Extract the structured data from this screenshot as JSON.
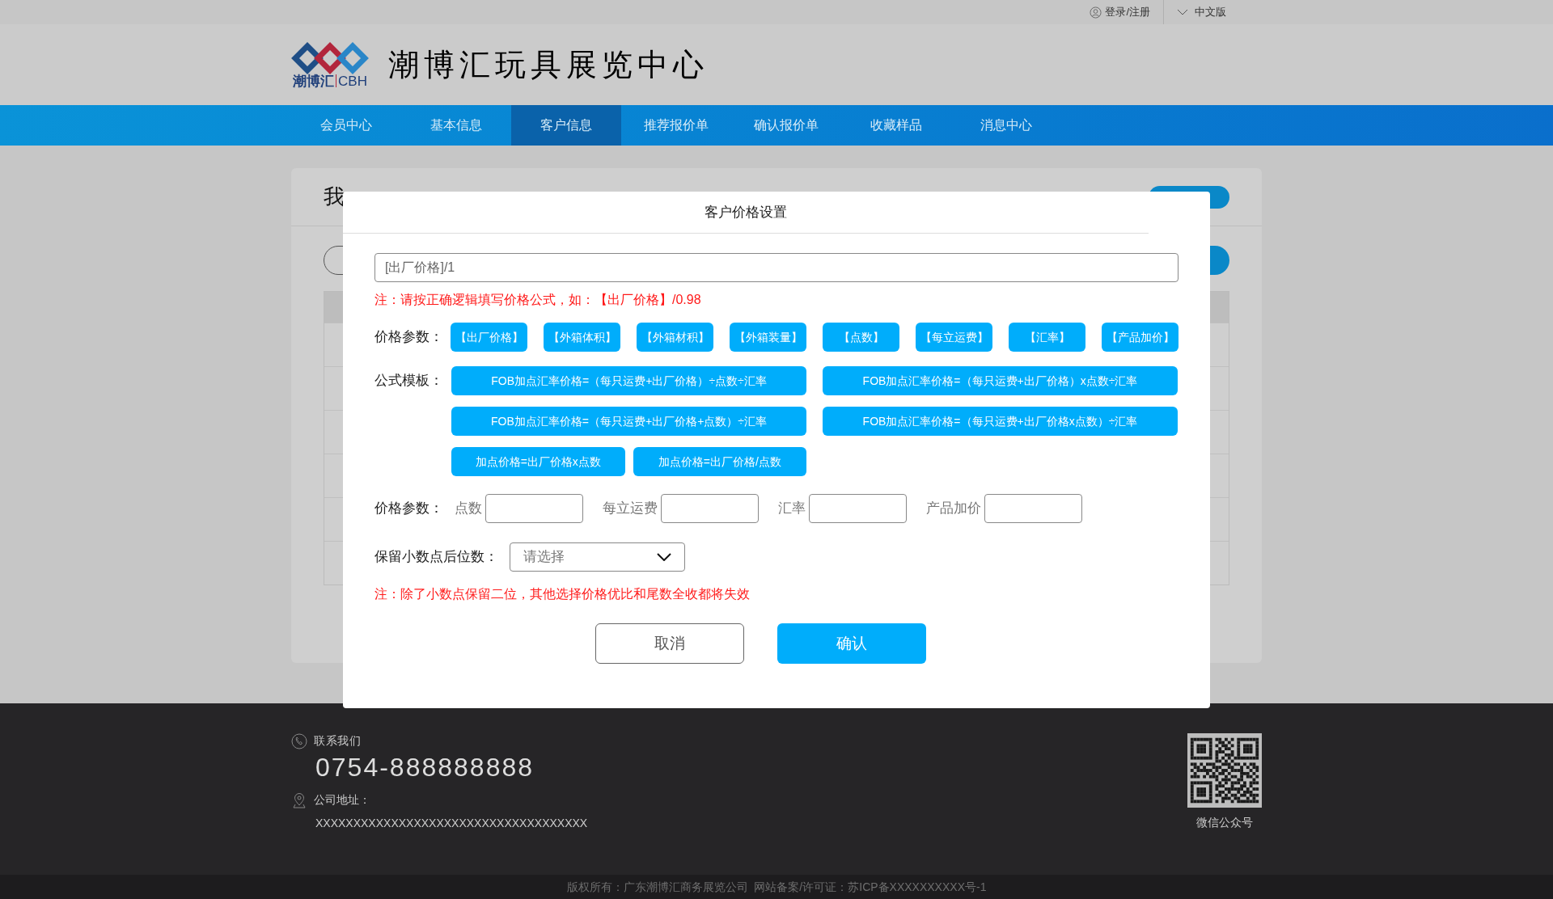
{
  "top_bar": {
    "login": "登录/注册",
    "language": "中文版"
  },
  "header": {
    "logo_cn": "潮博汇",
    "logo_en": "CBH",
    "site_title": "潮博汇玩具展览中心"
  },
  "nav": [
    {
      "label": "会员中心",
      "selected": false
    },
    {
      "label": "基本信息",
      "selected": false
    },
    {
      "label": "客户信息",
      "selected": true
    },
    {
      "label": "推荐报价单",
      "selected": false
    },
    {
      "label": "确认报价单",
      "selected": false
    },
    {
      "label": "收藏样品",
      "selected": false
    },
    {
      "label": "消息中心",
      "selected": false
    }
  ],
  "page": {
    "title": "我"
  },
  "dialog": {
    "title": "客户价格设置",
    "formula": "[出厂价格]/1",
    "note_formula": "注：请按正确逻辑填写价格公式，如：【出厂价格】/0.98",
    "param_label": "价格参数：",
    "params": [
      "【出厂价格】",
      "【外箱体积】",
      "【外箱材积】",
      "【外箱装量】",
      "【点数】",
      "【每立运费】",
      "【汇率】",
      "【产品加价】"
    ],
    "template_label": "公式模板：",
    "templates": [
      "FOB加点汇率价格=（每只运费+出厂价格）÷点数÷汇率",
      "FOB加点汇率价格=（每只运费+出厂价格）x点数÷汇率",
      "FOB加点汇率价格=（每只运费+出厂价格+点数）÷汇率",
      "FOB加点汇率价格=（每只运费+出厂价格x点数）÷汇率",
      "加点价格=出厂价格x点数",
      "加点价格=出厂价格/点数"
    ],
    "value_label": "价格参数：",
    "fields": [
      {
        "label": "点数"
      },
      {
        "label": "每立运费"
      },
      {
        "label": "汇率"
      },
      {
        "label": "产品加价"
      }
    ],
    "decimals_label": "保留小数点后位数：",
    "decimals_placeholder": "请选择",
    "note_decimals": "注：除了小数点保留二位，其他选择价格优比和尾数全收都将失效",
    "cancel": "取消",
    "confirm": "确认"
  },
  "footer": {
    "contact_label": "联系我们",
    "phone": "0754-888888888",
    "address_label": "公司地址：",
    "address": "XXXXXXXXXXXXXXXXXXXXXXXXXXXXXXXXXXXX",
    "qr_caption": "微信公众号",
    "copyright": "版权所有：广东潮博汇商务展览公司  网站备案/许可证：苏ICP备XXXXXXXXXX号-1"
  }
}
